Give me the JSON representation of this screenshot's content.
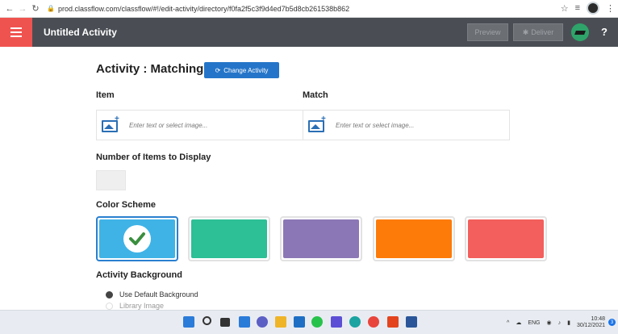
{
  "browser": {
    "url": "prod.classflow.com/classflow/#!/edit-activity/directory/f0fa2f5c3f9d4ed7b5d8cb261538b862"
  },
  "app": {
    "title": "Untitled Activity",
    "preview_label": "Preview",
    "deliver_label": "Deliver",
    "help_label": "?"
  },
  "activity": {
    "heading": "Activity : Matching",
    "change_button": "Change Activity",
    "item_label": "Item",
    "match_label": "Match",
    "item_placeholder": "Enter text or select image...",
    "match_placeholder": "Enter text or select image..."
  },
  "display": {
    "heading": "Number of Items to Display",
    "value": ""
  },
  "color_scheme": {
    "heading": "Color Scheme",
    "swatches": [
      {
        "color": "#3fb3e6",
        "selected": true
      },
      {
        "color": "#2dbf96",
        "selected": false
      },
      {
        "color": "#8b77b5",
        "selected": false
      },
      {
        "color": "#fd7b09",
        "selected": false
      },
      {
        "color": "#f25f5c",
        "selected": false
      }
    ]
  },
  "background": {
    "heading": "Activity Background",
    "options": [
      {
        "label": "Use Default Background",
        "selected": true
      },
      {
        "label": "Library Image",
        "selected": false
      }
    ]
  },
  "taskbar": {
    "lang": "ENG",
    "time": "10:48",
    "date": "30/12/2021",
    "notification_count": "3",
    "icons": [
      "windows-start-icon",
      "search-icon",
      "task-view-icon",
      "widgets-icon",
      "chat-icon",
      "file-explorer-icon",
      "mail-icon",
      "whatsapp-icon",
      "photo-editor-icon",
      "edge-icon",
      "chrome-icon",
      "office-icon",
      "word-icon"
    ]
  }
}
